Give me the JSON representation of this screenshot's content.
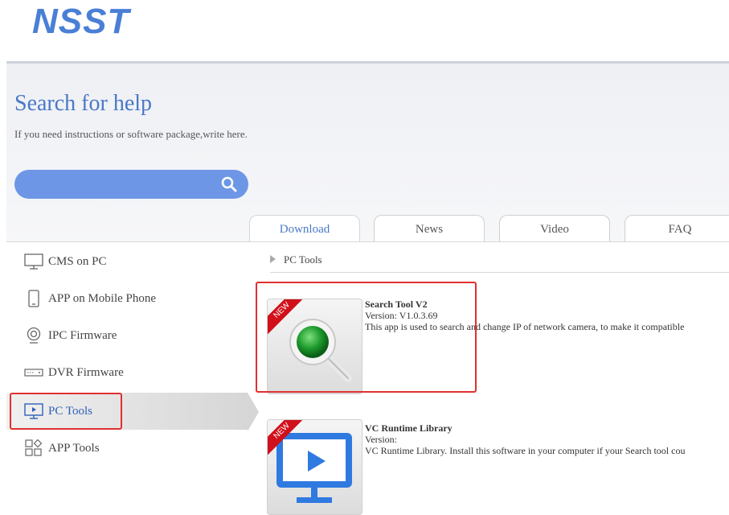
{
  "header": {
    "logo": "NSST"
  },
  "hero": {
    "title": "Search for help",
    "subtitle": "If you need instructions or software package,write here.",
    "search_placeholder": ""
  },
  "tabs": [
    {
      "label": "Download",
      "active": true
    },
    {
      "label": "News",
      "active": false
    },
    {
      "label": "Video",
      "active": false
    },
    {
      "label": "FAQ",
      "active": false
    }
  ],
  "sidebar": {
    "items": [
      {
        "label": "CMS on PC",
        "icon": "monitor-icon"
      },
      {
        "label": "APP on Mobile Phone",
        "icon": "phone-icon"
      },
      {
        "label": "IPC Firmware",
        "icon": "camera-icon"
      },
      {
        "label": "DVR Firmware",
        "icon": "dvr-icon"
      },
      {
        "label": "PC Tools",
        "icon": "pc-tools-icon",
        "active": true
      },
      {
        "label": "APP Tools",
        "icon": "app-tools-icon"
      }
    ]
  },
  "breadcrumb": {
    "label": "PC Tools"
  },
  "downloads": [
    {
      "badge": "NEW",
      "title": "Search Tool V2",
      "version": "Version: V1.0.3.69",
      "description": "This app is used to search and change IP of network camera, to make it compatible"
    },
    {
      "badge": "NEW",
      "title": "VC Runtime Library",
      "version": "Version:",
      "description": "VC Runtime Library. Install this software in your computer if your Search tool cou"
    }
  ],
  "colors": {
    "accent": "#4a78c8",
    "search_bar": "#6d96e6",
    "highlight": "#e03030",
    "badge": "#d0101a"
  }
}
